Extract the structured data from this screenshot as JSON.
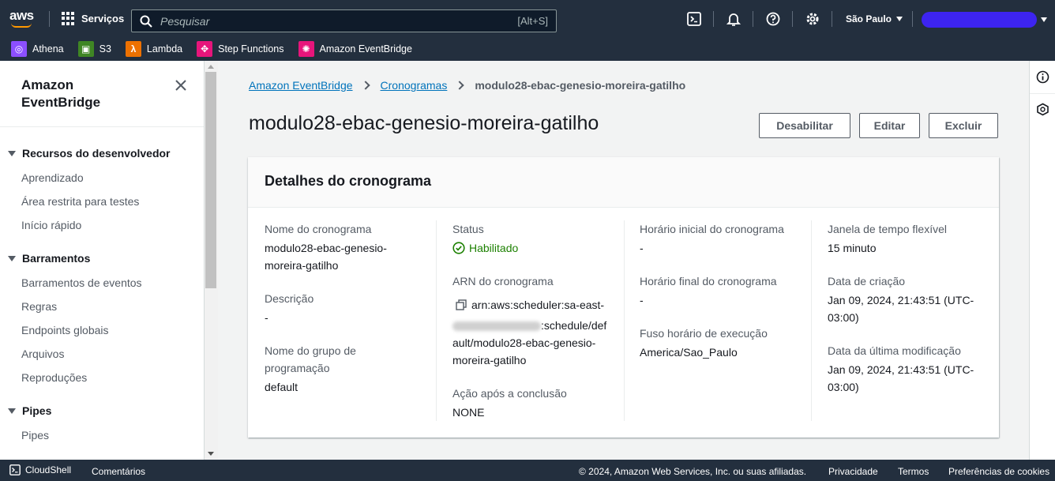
{
  "topnav": {
    "logo": "aws",
    "services_label": "Serviços",
    "search_placeholder": "Pesquisar",
    "search_shortcut": "[Alt+S]",
    "region": "São Paulo",
    "favorites": [
      {
        "label": "Athena",
        "color": "#8c4fff",
        "icon": "athena-icon"
      },
      {
        "label": "S3",
        "color": "#3f8624",
        "icon": "s3-icon"
      },
      {
        "label": "Lambda",
        "color": "#ed7100",
        "icon": "lambda-icon"
      },
      {
        "label": "Step Functions",
        "color": "#e7157b",
        "icon": "step-functions-icon"
      },
      {
        "label": "Amazon EventBridge",
        "color": "#e7157b",
        "icon": "eventbridge-icon"
      }
    ]
  },
  "sidebar": {
    "title": "Amazon EventBridge",
    "sections": [
      {
        "label": "Recursos do desenvolvedor",
        "items": [
          "Aprendizado",
          "Área restrita para testes",
          "Início rápido"
        ]
      },
      {
        "label": "Barramentos",
        "items": [
          "Barramentos de eventos",
          "Regras",
          "Endpoints globais",
          "Arquivos",
          "Reproduções"
        ]
      },
      {
        "label": "Pipes",
        "items": [
          "Pipes"
        ]
      }
    ]
  },
  "breadcrumb": {
    "items": [
      "Amazon EventBridge",
      "Cronogramas"
    ],
    "current": "modulo28-ebac-genesio-moreira-gatilho"
  },
  "page": {
    "title": "modulo28-ebac-genesio-moreira-gatilho",
    "buttons": {
      "disable": "Desabilitar",
      "edit": "Editar",
      "delete": "Excluir"
    }
  },
  "details": {
    "title": "Detalhes do cronograma",
    "name_label": "Nome do cronograma",
    "name_value_line1": "modulo28-ebac-genesio-",
    "name_value_line2": "moreira-gatilho",
    "description_label": "Descrição",
    "description_value": "-",
    "group_label_line1": "Nome do grupo de",
    "group_label_line2": "programação",
    "group_value": "default",
    "status_label": "Status",
    "status_value": "Habilitado",
    "arn_label": "ARN do cronograma",
    "arn_line1": "arn:aws:scheduler:sa-east-",
    "arn_line2_tail": ":schedule/def",
    "arn_line3": "ault/modulo28-ebac-genesio-",
    "arn_line4": "moreira-gatilho",
    "action_label": "Ação após a conclusão",
    "action_value": "NONE",
    "start_label": "Horário inicial do cronograma",
    "start_value": "-",
    "end_label": "Horário final do cronograma",
    "end_value": "-",
    "tz_label": "Fuso horário de execução",
    "tz_value": "America/Sao_Paulo",
    "flex_label": "Janela de tempo flexível",
    "flex_value": "15 minuto",
    "created_label": "Data de criação",
    "created_line1": "Jan 09, 2024, 21:43:51 (UTC-",
    "created_line2": "03:00)",
    "modified_label": "Data da última modificação",
    "modified_line1": "Jan 09, 2024, 21:43:51 (UTC-",
    "modified_line2": "03:00)"
  },
  "footer": {
    "cloudshell": "CloudShell",
    "comments": "Comentários",
    "copyright": "© 2024, Amazon Web Services, Inc. ou suas afiliadas.",
    "privacy": "Privacidade",
    "terms": "Termos",
    "cookies": "Preferências de cookies"
  }
}
